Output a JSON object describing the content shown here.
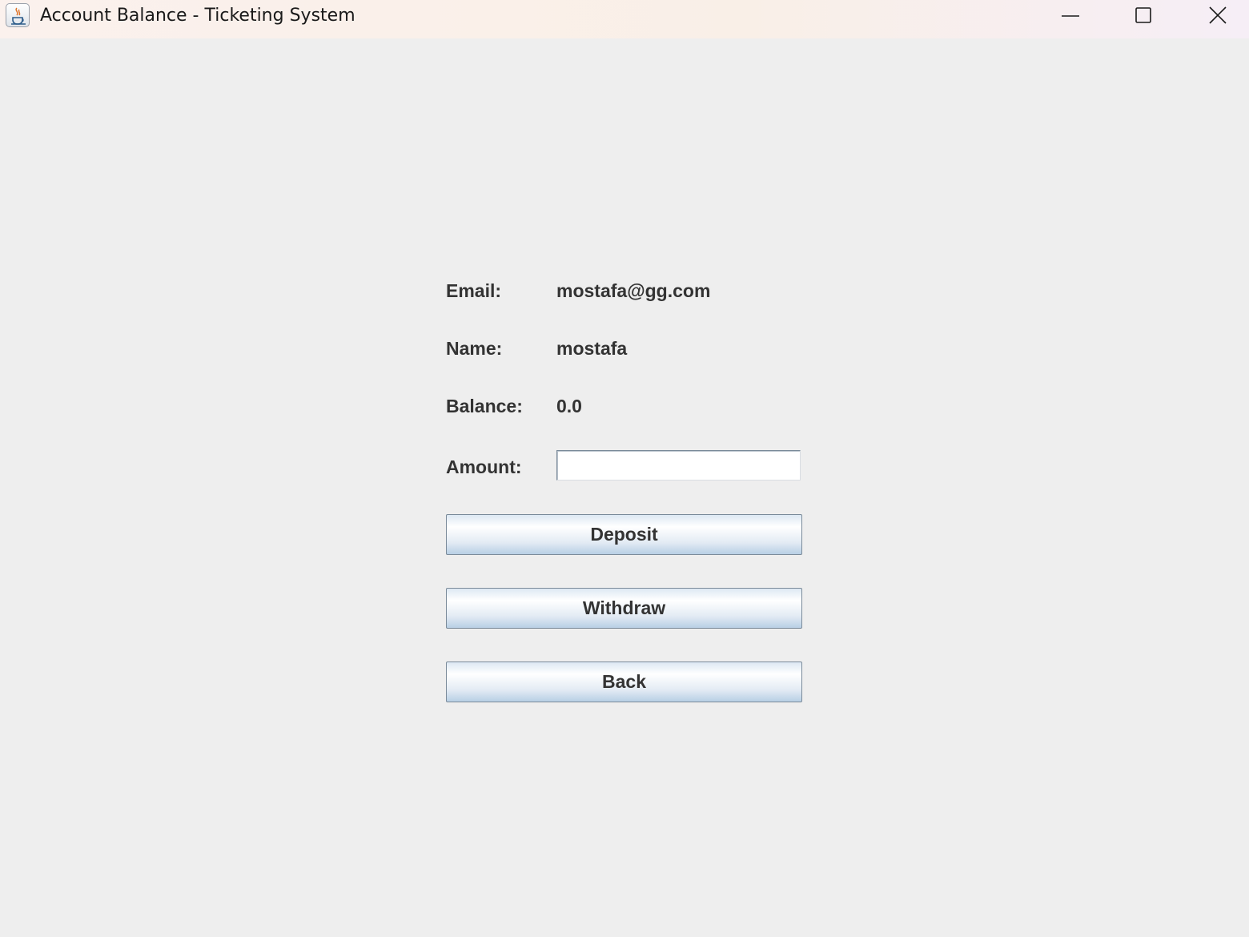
{
  "window": {
    "title": "Account Balance - Ticketing System",
    "icon": "java-cup-icon",
    "controls": [
      "minimize-icon",
      "maximize-icon",
      "close-icon"
    ]
  },
  "account": {
    "email_label": "Email:",
    "email_value": "mostafa@gg.com",
    "name_label": "Name:",
    "name_value": "mostafa",
    "balance_label": "Balance:",
    "balance_value": "0.0",
    "amount_label": "Amount:",
    "amount_value": ""
  },
  "actions": {
    "deposit_label": "Deposit",
    "withdraw_label": "Withdraw",
    "back_label": "Back"
  },
  "colors": {
    "background": "#eeeeee",
    "text": "#333333",
    "button_border": "#7a8a99",
    "button_gradient_bottom": "#b8cfe5"
  }
}
